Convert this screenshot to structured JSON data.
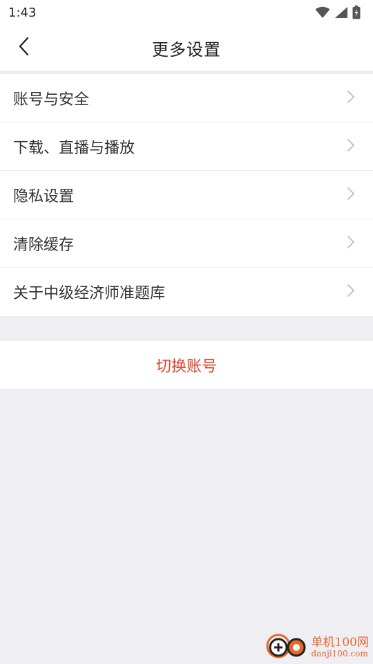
{
  "status_bar": {
    "time": "1:43",
    "icons": [
      "wifi-icon",
      "cellular-signal-icon",
      "battery-charging-icon"
    ]
  },
  "header": {
    "title": "更多设置",
    "back_icon": "chevron-left-icon"
  },
  "menu": {
    "items": [
      {
        "label": "账号与安全"
      },
      {
        "label": "下载、直播与播放"
      },
      {
        "label": "隐私设置"
      },
      {
        "label": "清除缓存"
      },
      {
        "label": "关于中级经济师准题库"
      }
    ]
  },
  "switch_account": {
    "label": "切换账号",
    "color": "#d9462c"
  },
  "watermark": {
    "title": "单机100网",
    "subtitle": "danji100.com"
  },
  "colors": {
    "background": "#efeff3",
    "surface": "#ffffff",
    "text_primary": "#333333",
    "accent": "#d9462c",
    "chevron": "#bdbdbd"
  }
}
